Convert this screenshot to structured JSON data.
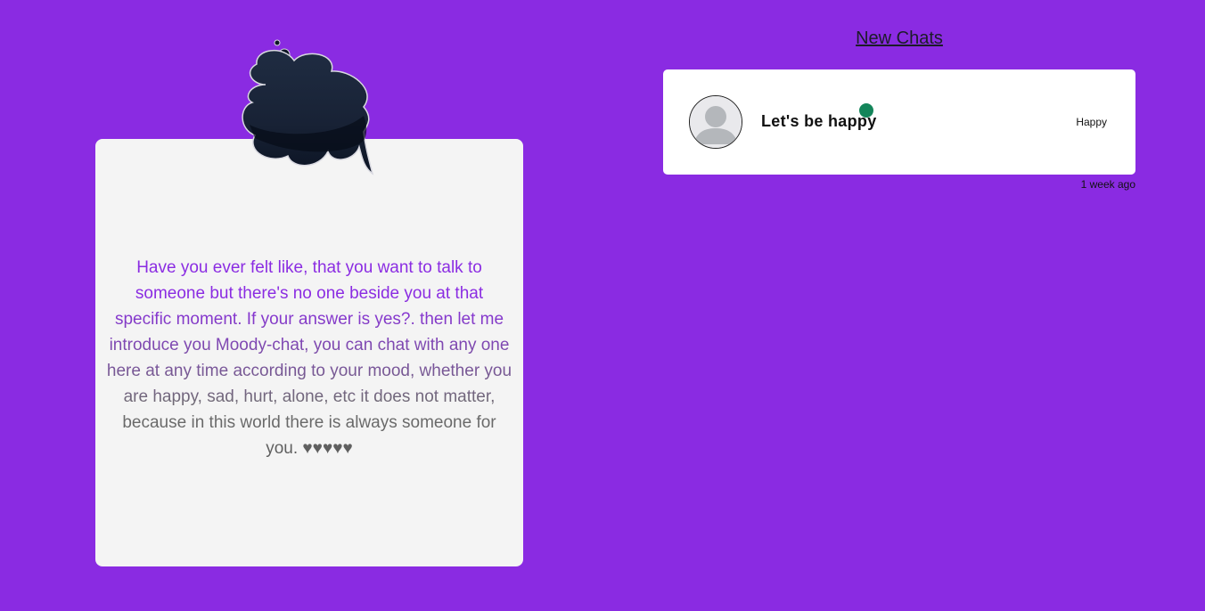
{
  "intro": {
    "text": "Have you ever felt like, that you want to talk to someone but there's no one beside you at that specific moment. If your answer is yes?. then let me introduce you Moody-chat, you can chat with any one here at any time according to your mood, whether you are happy, sad, hurt, alone, etc it does not matter, because in this world there is always someone for you. ♥♥♥♥♥",
    "logo_icon": "thought-cloud-icon"
  },
  "chats": {
    "title": "New Chats",
    "items": [
      {
        "name": "Let's be happy",
        "mood": "Happy",
        "time": "1 week ago",
        "status": "online",
        "avatar_icon": "default-avatar-icon"
      }
    ]
  },
  "colors": {
    "background": "#8a2be2",
    "card": "#f4f4f4",
    "online": "#13855a",
    "cloud": "#1a2638"
  }
}
